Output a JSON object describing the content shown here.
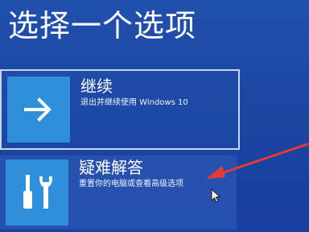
{
  "screen": {
    "title": "选择一个选项",
    "background_color": "#1d47a3"
  },
  "options": [
    {
      "title": "继续",
      "description": "退出并继续使用 Windows 10",
      "icon": "arrow-right-icon",
      "tile_color": "#2f8fdb",
      "selected": true
    },
    {
      "title": "疑难解答",
      "description": "重置你的电脑或查看高级选项",
      "icon": "tools-icon",
      "tile_color": "#2f8fdb",
      "selected": false
    }
  ],
  "overlay": {
    "annotation_arrow_color": "#e53935",
    "annotation_arrow_icon": "red-arrow-annotation",
    "cursor_icon": "mouse-cursor-icon"
  }
}
